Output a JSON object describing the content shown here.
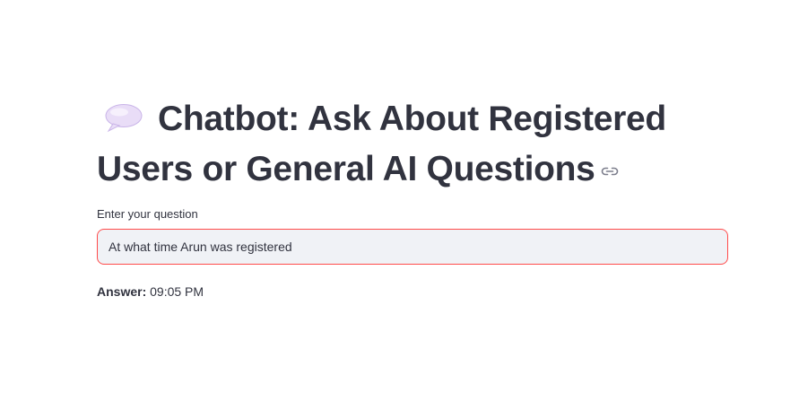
{
  "header": {
    "emoji_icon": "speech-balloon-icon",
    "title_line1": "Chatbot: Ask About Registered",
    "title_line2": "Users or General AI Questions",
    "anchor_icon": "link-icon"
  },
  "question": {
    "label": "Enter your question",
    "value": "At what time Arun was registered"
  },
  "answer": {
    "label": "Answer:",
    "value": "09:05 PM"
  },
  "colors": {
    "text": "#31333f",
    "input_background": "#f0f2f6",
    "input_focus_border": "#ff4b4b",
    "emoji_fill": "#e6d8f5"
  }
}
